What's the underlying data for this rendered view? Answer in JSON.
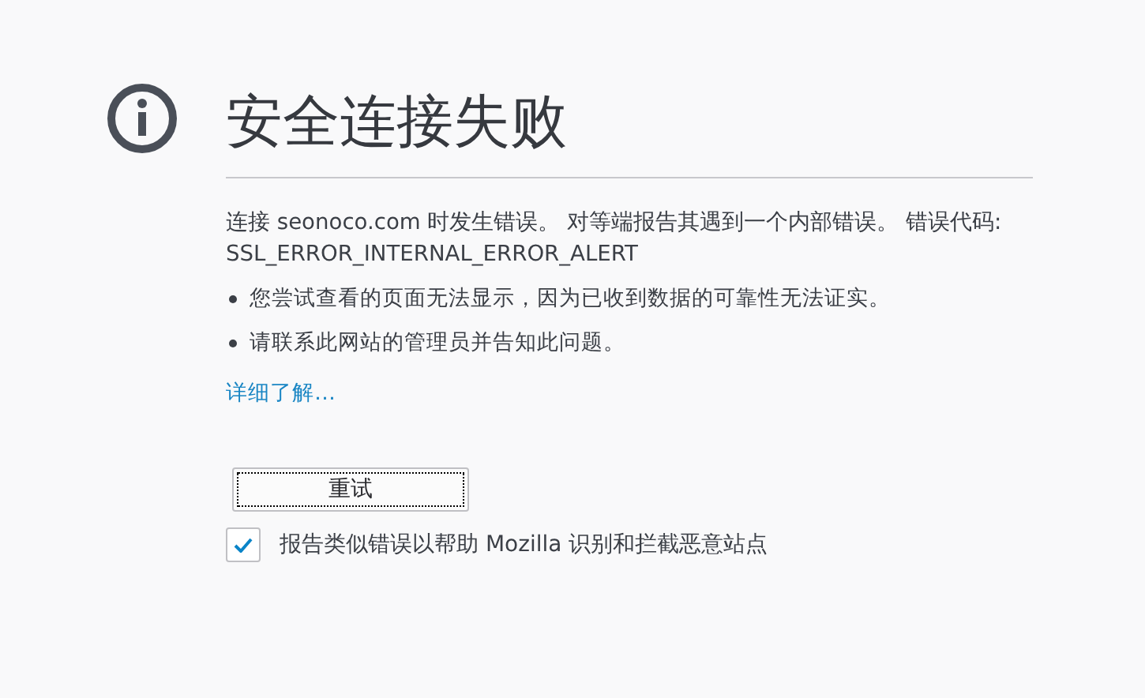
{
  "title": "安全连接失败",
  "description": "连接 seonoco.com 时发生错误。 对等端报告其遇到一个内部错误。 错误代码: SSL_ERROR_INTERNAL_ERROR_ALERT",
  "bullets": [
    "您尝试查看的页面无法显示，因为已收到数据的可靠性无法证实。",
    "请联系此网站的管理员并告知此问题。"
  ],
  "learn_more_link": "详细了解…",
  "retry_button": {
    "label": "重试",
    "focused": true
  },
  "report_checkbox": {
    "label": "报告类似错误以帮助 Mozilla 识别和拦截恶意站点",
    "checked": true
  }
}
